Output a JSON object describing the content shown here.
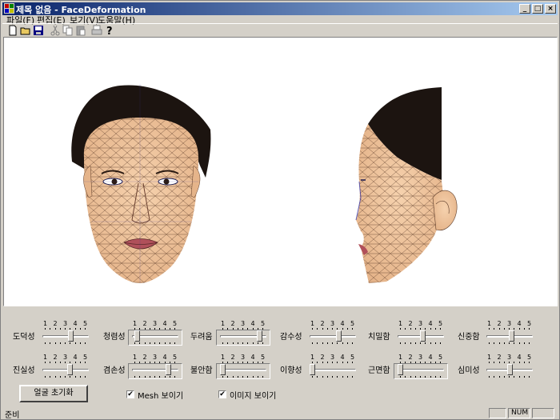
{
  "window": {
    "title": "제목 없음 - FaceDeformation"
  },
  "menu": [
    "파일(F)",
    "편집(E)",
    "보기(V)",
    "도움말(H)"
  ],
  "toolbar": [
    "new-icon",
    "open-icon",
    "save-icon",
    "cut-icon",
    "copy-icon",
    "paste-icon",
    "print-icon",
    "help-icon"
  ],
  "sliders": {
    "tick_labels": [
      "1",
      "2",
      "3",
      "4",
      "5"
    ],
    "row1": [
      {
        "label": "도덕성",
        "value": 3.5
      },
      {
        "label": "청렴성",
        "value": 1.2
      },
      {
        "label": "두려움",
        "value": 4.6
      },
      {
        "label": "감수성",
        "value": 3.6
      },
      {
        "label": "치밀함",
        "value": 3.2
      },
      {
        "label": "신중함",
        "value": 3.2
      }
    ],
    "row2": [
      {
        "label": "진실성",
        "value": 3.4
      },
      {
        "label": "겸손성",
        "value": 4.3
      },
      {
        "label": "불안함",
        "value": 1.0
      },
      {
        "label": "이향성",
        "value": 1.0
      },
      {
        "label": "근면함",
        "value": 1.0
      },
      {
        "label": "심미성",
        "value": 3.0
      }
    ]
  },
  "controls": {
    "reset_button": "얼굴 초기화",
    "mesh_checkbox": {
      "label": "Mesh 보이기",
      "checked": true
    },
    "image_checkbox": {
      "label": "이미지 보이기",
      "checked": true
    }
  },
  "status": {
    "text": "준비",
    "num": "NUM"
  }
}
